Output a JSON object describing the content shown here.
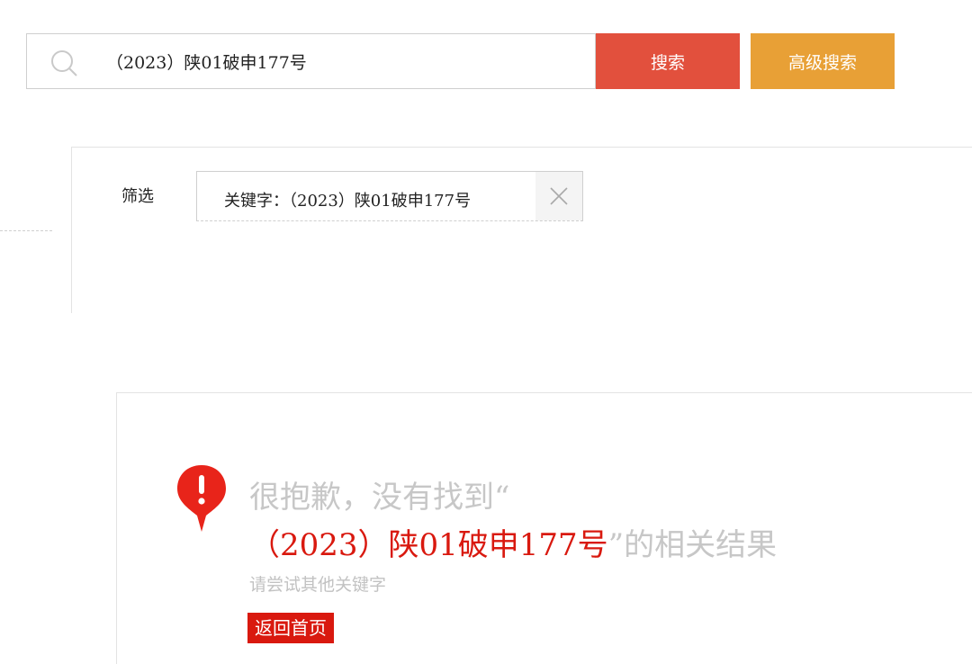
{
  "search": {
    "value": "（2023）陕01破申177号",
    "search_button": "搜索",
    "advanced_button": "高级搜索"
  },
  "filter": {
    "label": "筛选",
    "chip_text": "关键字：（2023）陕01破申177号"
  },
  "result": {
    "line1": "很抱歉，没有找到“",
    "keyword": "（2023）陕01破申177号",
    "line2_suffix": "”的相关结果",
    "hint": "请尝试其他关键字",
    "home_button": "返回首页"
  },
  "colors": {
    "search_button": "#e2503d",
    "advanced_button": "#e8a036",
    "accent_red": "#d9190f"
  }
}
